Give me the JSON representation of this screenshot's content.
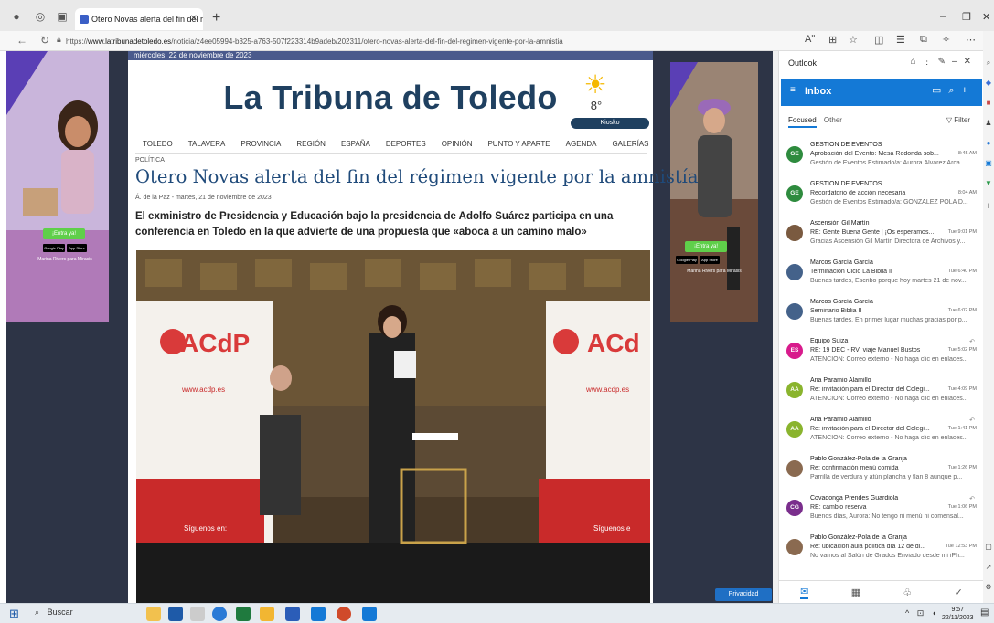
{
  "browser": {
    "tab_title": "Otero Novas alerta del fin del ré",
    "url_prefix": "https://",
    "url_domain": "www.latribunadetoledo.es",
    "url_path": "/noticia/z4ee05994-b325-a763-507f223314b9adeb/202311/otero-novas-alerta-del-fin-del-regimen-vigente-por-la-amnistia",
    "reader_label": "Aʺ"
  },
  "page": {
    "date": "miércoles, 22 de noviembre de 2023",
    "masthead": "La Tribuna de Toledo",
    "weather_temp": "8°",
    "kiosko": "Kiosko",
    "nav": [
      "TOLEDO",
      "TALAVERA",
      "PROVINCIA",
      "REGIÓN",
      "ESPAÑA",
      "DEPORTES",
      "OPINIÓN",
      "PUNTO Y APARTE",
      "AGENDA",
      "GALERÍAS"
    ],
    "section": "POLÍTICA",
    "headline": "Otero Novas alerta del fin del régimen vigente por la amnistía",
    "byline": "Á. de la Paz - martes, 21 de noviembre de 2023",
    "subtitle": "El exministro de Presidencia y Educación bajo la presidencia de Adolfo Suárez participa en una conferencia en Toledo en la que advierte de una propuesta que «aboca a un camino malo»",
    "photo_banner_left": "ACdP",
    "photo_banner_right": "ACd",
    "photo_web_left": "www.acdp.es",
    "photo_web_right": "www.acdp.es",
    "photo_follow_left": "Síguenos en:",
    "photo_follow_right": "Síguenos e",
    "privacy": "Privacidad"
  },
  "ads": {
    "cta": "¡Entra ya!",
    "google_play": "Google Play",
    "app_store": "App Store",
    "caption": "Marina Rivers para Mirasis"
  },
  "outlook": {
    "app_title": "Outlook",
    "folder": "Inbox",
    "tab_focused": "Focused",
    "tab_other": "Other",
    "filter": "Filter",
    "messages": [
      {
        "initials": "GE",
        "color": "#2e8b3e",
        "from": "GESTION DE EVENTOS",
        "subject": "Aprobación del Evento: Mesa Redonda sob...",
        "time": "8:45 AM",
        "preview": "Gestión de Eventos Estimado/a: Aurora Álvarez Arca...",
        "flag": ""
      },
      {
        "initials": "GE",
        "color": "#2e8b3e",
        "from": "GESTION DE EVENTOS",
        "subject": "Recordatorio de acción necesaria",
        "time": "8:04 AM",
        "preview": "Gestión de Eventos Estimado/a: GONZÁLEZ POLA D...",
        "flag": ""
      },
      {
        "initials": "",
        "color": "#7a5a40",
        "from": "Ascensión Gil Martín",
        "subject": "RE: Gente Buena Gente | ¡Os esperamos...",
        "time": "Tue 9:01 PM",
        "preview": "Gracias Ascensión Gil Martín Directora de Archivos y...",
        "flag": ""
      },
      {
        "initials": "",
        "color": "#44628a",
        "from": "Marcos García García",
        "subject": "Terminación Ciclo La Biblia II",
        "time": "Tue 6:40 PM",
        "preview": "Buenas tardes, Escribo porque hoy martes 21 de nov...",
        "flag": ""
      },
      {
        "initials": "",
        "color": "#44628a",
        "from": "Marcos García García",
        "subject": "Seminario Biblia II",
        "time": "Tue 6:02 PM",
        "preview": "Buenas tardes, En primer lugar muchas gracias por p...",
        "flag": ""
      },
      {
        "initials": "ES",
        "color": "#d81b8c",
        "from": "Equipo Suiza",
        "subject": "RE: 19 DEC - RV: viaje Manuel Bustos",
        "time": "Tue 5:02 PM",
        "preview": "ATENCIÓN: Correo externo - No haga clic en enlaces...",
        "flag": "↶"
      },
      {
        "initials": "AA",
        "color": "#8ab42e",
        "from": "Ana Paramio Alamillo",
        "subject": "Re: invitación para el Director del Colegi...",
        "time": "Tue 4:09 PM",
        "preview": "ATENCIÓN: Correo externo - No haga clic en enlaces...",
        "flag": ""
      },
      {
        "initials": "AA",
        "color": "#8ab42e",
        "from": "Ana Paramio Alamillo",
        "subject": "Re: invitación para el Director del Colegi...",
        "time": "Tue 1:41 PM",
        "preview": "ATENCIÓN: Correo externo - No haga clic en enlaces...",
        "flag": "↶"
      },
      {
        "initials": "",
        "color": "#8a6a50",
        "from": "Pablo González-Pola de la Granja",
        "subject": "Re: confirmación menú comida",
        "time": "Tue 1:26 PM",
        "preview": "Parrilla de verdura y atún plancha y flan 8 aunque p...",
        "flag": ""
      },
      {
        "initials": "CG",
        "color": "#7a2e8c",
        "from": "Covadonga Prendes Guardiola",
        "subject": "RE: cambio reserva",
        "time": "Tue 1:06 PM",
        "preview": "Buenos días, Aurora: No tengo ni menú ni comensal...",
        "flag": "↶"
      },
      {
        "initials": "",
        "color": "#8a6a50",
        "from": "Pablo González-Pola de la Granja",
        "subject": "Re: ubicación aula política día 12 de di...",
        "time": "Tue 12:53 PM",
        "preview": "No vamos al Salón de Grados Enviado desde mi iPh...",
        "flag": ""
      }
    ]
  },
  "taskbar": {
    "search": "Buscar",
    "time": "9:57",
    "date": "22/11/2023"
  }
}
